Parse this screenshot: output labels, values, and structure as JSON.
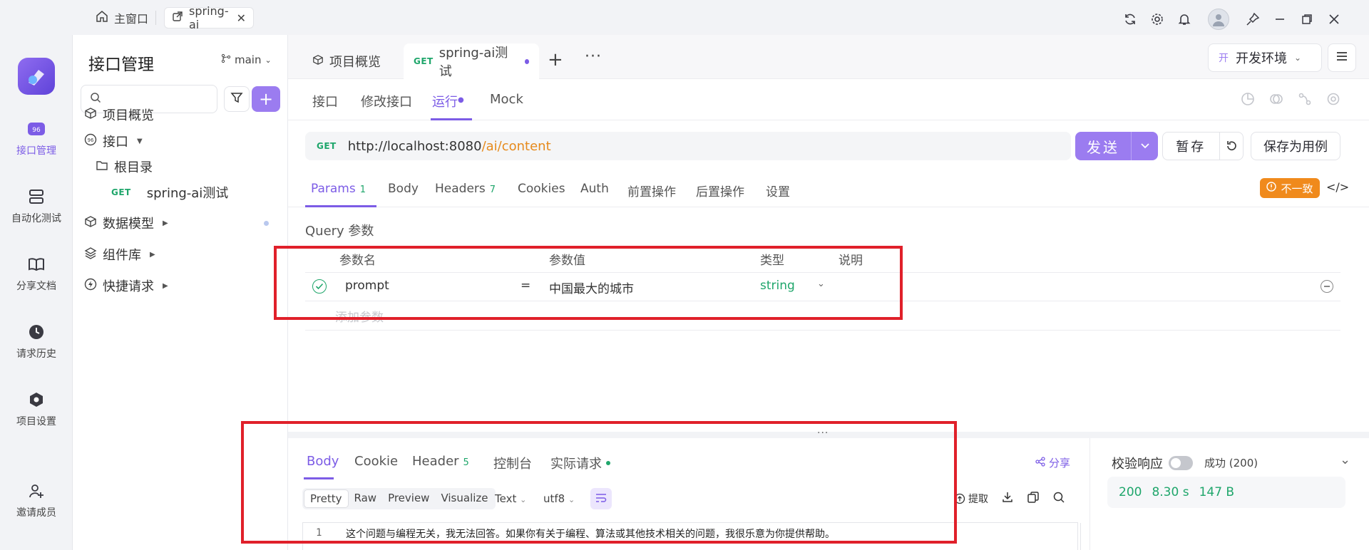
{
  "titlebar": {
    "home_label": "主窗口",
    "tab_label": "spring-ai",
    "icons": [
      "refresh-icon",
      "gear-icon",
      "bell-icon",
      "pin-icon",
      "minimize-icon",
      "restore-icon",
      "close-icon"
    ]
  },
  "rail": {
    "items": [
      {
        "label": "接口管理",
        "icon": "api-icon",
        "active": true
      },
      {
        "label": "自动化测试",
        "icon": "automation-icon"
      },
      {
        "label": "分享文档",
        "icon": "book-icon"
      },
      {
        "label": "请求历史",
        "icon": "clock-icon"
      },
      {
        "label": "项目设置",
        "icon": "settings-hex-icon"
      },
      {
        "label": "邀请成员",
        "icon": "user-plus-icon"
      }
    ]
  },
  "tree": {
    "title": "接口管理",
    "branch": "main",
    "items": {
      "overview": "项目概览",
      "apis": "接口",
      "root": "根目录",
      "api_method": "GET",
      "api_name": "spring-ai测试",
      "models": "数据模型",
      "components": "组件库",
      "quick": "快捷请求"
    }
  },
  "doc_tabs": {
    "overview": "项目概览",
    "method": "GET",
    "current": "spring-ai测试",
    "env_badge": "开",
    "env": "开发环境"
  },
  "sub_tabs": [
    "接口",
    "修改接口",
    "运行",
    "Mock"
  ],
  "request": {
    "method": "GET",
    "url_base": "http://localhost:8080",
    "url_path": "/ai/content",
    "send": "发送",
    "save_temp": "暂存",
    "save_case": "保存为用例"
  },
  "param_tabs": {
    "params": "Params",
    "params_count": "1",
    "body": "Body",
    "headers": "Headers",
    "headers_count": "7",
    "cookies": "Cookies",
    "auth": "Auth",
    "pre": "前置操作",
    "post": "后置操作",
    "settings": "设置",
    "mismatch": "不一致"
  },
  "query": {
    "title": "Query 参数",
    "headers": {
      "name": "参数名",
      "value": "参数值",
      "type": "类型",
      "desc": "说明"
    },
    "row": {
      "name": "prompt",
      "eq": "=",
      "value": "中国最大的城市",
      "type": "string"
    },
    "add_placeholder": "添加参数"
  },
  "response": {
    "tabs": {
      "body": "Body",
      "cookie": "Cookie",
      "header": "Header",
      "header_count": "5",
      "console": "控制台",
      "actual": "实际请求"
    },
    "share": "分享",
    "formats": [
      "Pretty",
      "Raw",
      "Preview",
      "Visualize"
    ],
    "text_type": "Text",
    "encoding": "utf8",
    "extract": "提取",
    "line_no": "1",
    "content": "这个问题与编程无关，我无法回答。如果你有关于编程、算法或其他技术相关的问题，我很乐意为你提供帮助。",
    "validate": "校验响应",
    "success": "成功 (200)",
    "status_code": "200",
    "time": "8.30 s",
    "size": "147 B"
  }
}
